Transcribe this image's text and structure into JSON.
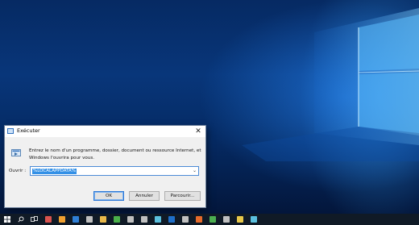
{
  "dialog": {
    "title": "Exécuter",
    "close_symbol": "✕",
    "description": "Entrez le nom d'un programme, dossier, document ou ressource Internet, et Windows l'ouvrira pour vous.",
    "open_label": "Ouvrir :",
    "open_value": "%LOCALAPPDATA%",
    "buttons": {
      "ok": "OK",
      "cancel": "Annuler",
      "browse": "Parcourir..."
    }
  },
  "taskbar": {
    "items": [
      {
        "name": "start-icon",
        "color": "#ffffff"
      },
      {
        "name": "search-icon",
        "color": "#ffffff"
      },
      {
        "name": "task-view-icon",
        "color": "#ffffff"
      },
      {
        "name": "calculator-icon",
        "color": "#d9534f"
      },
      {
        "name": "store-icon",
        "color": "#f0a030"
      },
      {
        "name": "edge-icon",
        "color": "#2f7fd6"
      },
      {
        "name": "app-icon",
        "color": "#c0c0c0"
      },
      {
        "name": "file-explorer-icon",
        "color": "#e8b84a"
      },
      {
        "name": "media-icon",
        "color": "#4ab04a"
      },
      {
        "name": "app-icon",
        "color": "#c0c0c0"
      },
      {
        "name": "app-icon",
        "color": "#c0c0c0"
      },
      {
        "name": "app-icon",
        "color": "#5bc0de"
      },
      {
        "name": "outlook-icon",
        "color": "#1f6fc9"
      },
      {
        "name": "app-icon",
        "color": "#c0c0c0"
      },
      {
        "name": "firefox-icon",
        "color": "#e66b2b"
      },
      {
        "name": "chrome-icon",
        "color": "#4caf50"
      },
      {
        "name": "app-icon",
        "color": "#c0c0c0"
      },
      {
        "name": "app-icon",
        "color": "#e8c84a"
      },
      {
        "name": "app-icon",
        "color": "#5bc0de"
      }
    ]
  }
}
